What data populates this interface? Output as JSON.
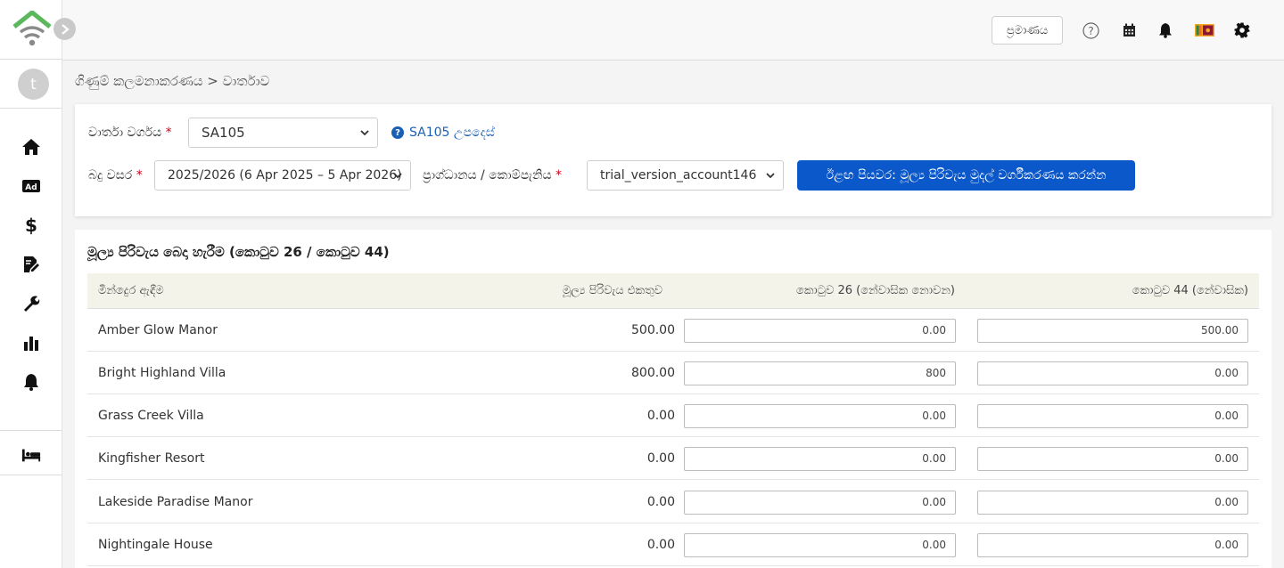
{
  "topbar": {
    "standard_button": "ප්‍රමාණය",
    "icons": [
      "help-icon",
      "calendar-icon",
      "bell-icon",
      "flag-icon",
      "gear-icon"
    ]
  },
  "sidebar": {
    "avatar_initial": "t",
    "items": [
      "home-icon",
      "ad-icon",
      "dollar-icon",
      "document-edit-icon",
      "wrench-icon",
      "bar-chart-icon",
      "bell-icon",
      "bed-icon"
    ]
  },
  "breadcrumb": "ගිණුම් කලමනාකරණය > වාර්තාව",
  "filters": {
    "report_type_label": "වාර්තා වර්ගය",
    "report_type_value": "SA105",
    "help_link": "SA105 උපදෙස්",
    "tax_year_label": "බදු වසර",
    "tax_year_value": "2025/2026 (6 Apr 2025 – 5 Apr 2026)",
    "company_label": "ප්‍රාග්ධානය / කොම්පැනිය",
    "company_value": "trial_version_account146",
    "next_button": "ඊළඟ පියවර: මූල්‍ය පිරිවැය මුදල් වර්ගීකරණය කරන්න"
  },
  "table": {
    "title": "මූල්‍ය පිරිවැය බෙදා හැරීම (කොටුව 26 / කොටුව 44)",
    "columns": [
      "මින්දෙුර ඇඳීම",
      "මූල්‍ය පිරිවැය එකතුව",
      "කොටුව 26 (නේවාසික නොවන)",
      "කොටුව 44 (නේවාසික)"
    ],
    "rows": [
      {
        "name": "Amber Glow Manor",
        "total": "500.00",
        "box26": "0.00",
        "box44": "500.00"
      },
      {
        "name": "Bright Highland Villa",
        "total": "800.00",
        "box26": "800",
        "box44": "0.00"
      },
      {
        "name": "Grass Creek Villa",
        "total": "0.00",
        "box26": "0.00",
        "box44": "0.00"
      },
      {
        "name": "Kingfisher Resort",
        "total": "0.00",
        "box26": "0.00",
        "box44": "0.00"
      },
      {
        "name": "Lakeside Paradise Manor",
        "total": "0.00",
        "box26": "0.00",
        "box44": "0.00"
      },
      {
        "name": "Nightingale House",
        "total": "0.00",
        "box26": "0.00",
        "box44": "0.00"
      }
    ]
  },
  "colors": {
    "primary_button": "#0a58ca",
    "link": "#1a5fb4",
    "logo_green": "#5cb85c",
    "logo_grey": "#8a8a8a"
  }
}
